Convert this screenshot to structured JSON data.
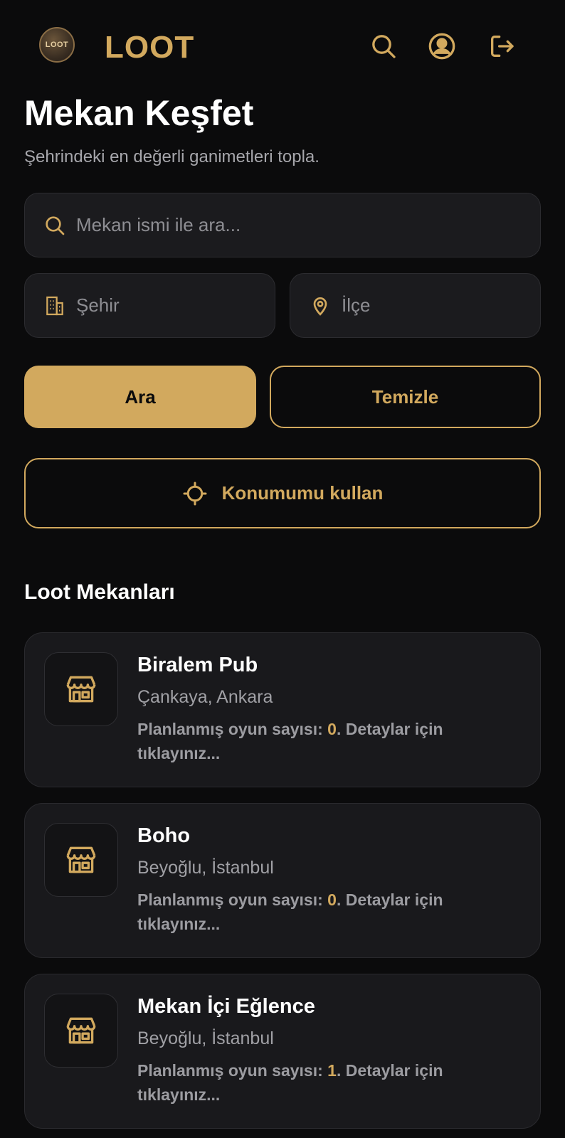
{
  "header": {
    "logo_text": "LOOT",
    "brand": "LOOT",
    "icons": [
      "search-icon",
      "profile-icon",
      "logout-icon"
    ]
  },
  "page": {
    "title": "Mekan Keşfet",
    "subtitle": "Şehrindeki en değerli ganimetleri topla."
  },
  "search": {
    "placeholder": "Mekan ismi ile ara...",
    "city_placeholder": "Şehir",
    "district_placeholder": "İlçe"
  },
  "buttons": {
    "search_label": "Ara",
    "clear_label": "Temizle",
    "location_label": "Konumumu kullan"
  },
  "section": {
    "title": "Loot Mekanları"
  },
  "venues": [
    {
      "name": "Biralem Pub",
      "location": "Çankaya, Ankara",
      "info_prefix": "Planlanmış oyun sayısı: ",
      "count": "0",
      "info_suffix": ". Detaylar için tıklayınız..."
    },
    {
      "name": "Boho",
      "location": "Beyoğlu, İstanbul",
      "info_prefix": "Planlanmış oyun sayısı: ",
      "count": "0",
      "info_suffix": ". Detaylar için tıklayınız..."
    },
    {
      "name": "Mekan İçi Eğlence",
      "location": "Beyoğlu, İstanbul",
      "info_prefix": "Planlanmış oyun sayısı: ",
      "count": "1",
      "info_suffix": ". Detaylar için tıklayınız..."
    }
  ],
  "colors": {
    "background": "#0b0b0c",
    "accent": "#d2a95e",
    "card": "#19191c",
    "muted_text": "#a0a0a5"
  }
}
